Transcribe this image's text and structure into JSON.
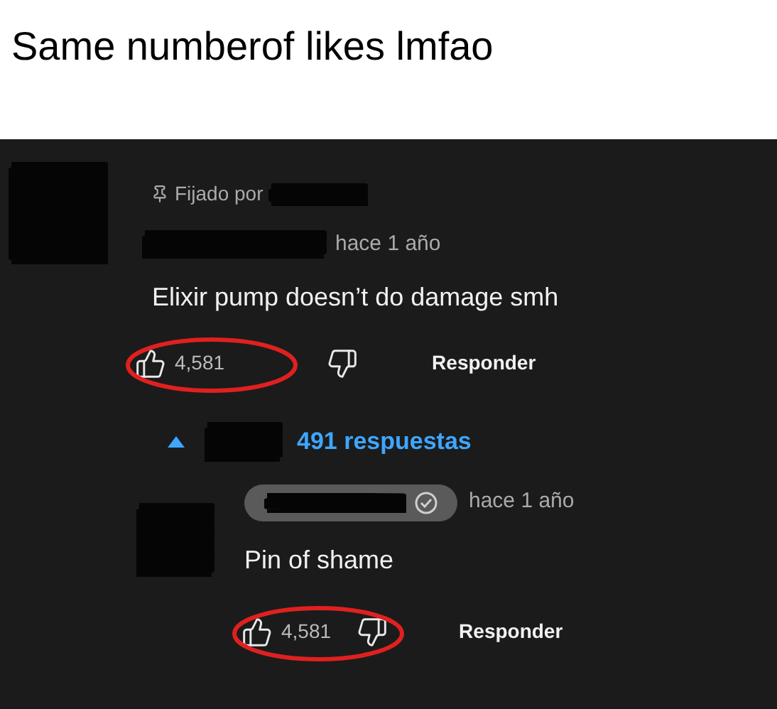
{
  "caption": "Same numberof likes lmfao",
  "comment": {
    "pinned_label": "Fijado por",
    "time": "hace 1 año",
    "text": "Elixir pump doesn’t do damage smh",
    "likes": "4,581",
    "reply_button": "Responder"
  },
  "replies_toggle": {
    "label": "491 respuestas"
  },
  "reply": {
    "time": "hace 1 año",
    "text": "Pin of shame",
    "likes": "4,581",
    "reply_button": "Responder"
  }
}
